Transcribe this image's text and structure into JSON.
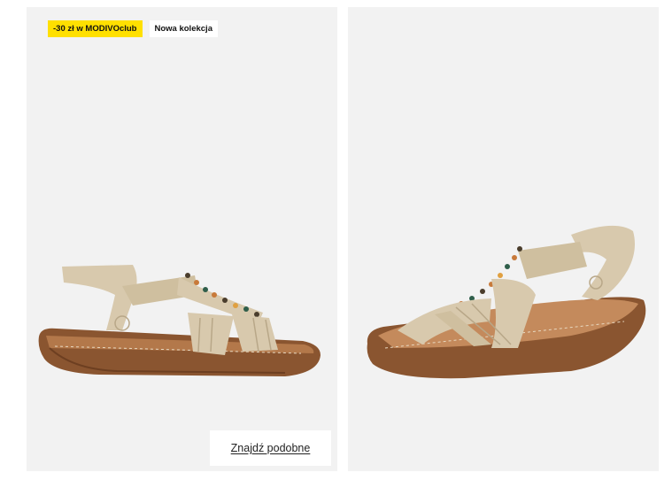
{
  "badges": {
    "promo": "-30 zł w MODIVOclub",
    "new_collection": "Nowa kolekcja"
  },
  "actions": {
    "find_similar": "Znajdź podobne"
  },
  "colors": {
    "promo_badge": "#ffe000",
    "photo_background": "#f2f2f2",
    "strap": "#d8c9ad",
    "sole": "#8a5530"
  },
  "icons": {
    "left_image": "sandal-side-view",
    "right_image": "sandal-three-quarter-view"
  }
}
